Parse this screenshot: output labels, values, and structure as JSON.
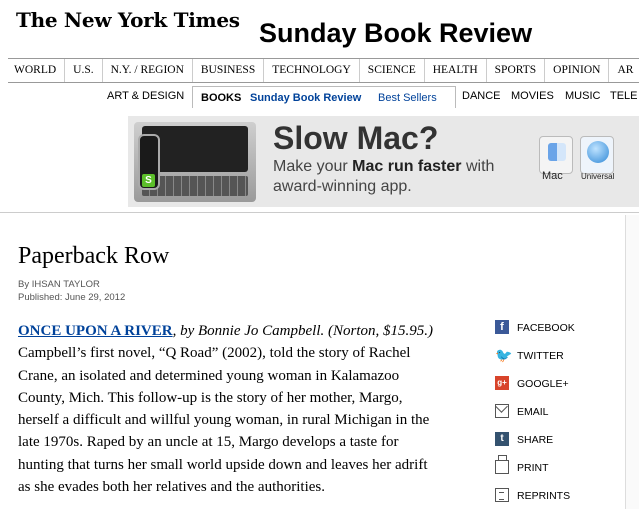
{
  "masthead": {
    "logo": "The New York Times",
    "section_title": "Sunday Book Review"
  },
  "nav_primary": [
    "WORLD",
    "U.S.",
    "N.Y. / REGION",
    "BUSINESS",
    "TECHNOLOGY",
    "SCIENCE",
    "HEALTH",
    "SPORTS",
    "OPINION",
    "AR"
  ],
  "nav_secondary": {
    "art_design": "ART & DESIGN",
    "books": "BOOKS",
    "sunday_book_review": "Sunday Book Review",
    "best_sellers": "Best Sellers",
    "dance": "DANCE",
    "movies": "MOVIES",
    "music": "MUSIC",
    "tele": "TELE"
  },
  "ad": {
    "headline": "Slow Mac?",
    "line1_prefix": "Make your ",
    "line1_bold": "Mac run faster",
    "line1_suffix": " with",
    "line2": "award-winning app.",
    "badge": "S",
    "icon1_label": "Mac",
    "icon2_label": "Universal"
  },
  "article": {
    "headline": "Paperback Row",
    "byline": "By IHSAN TAYLOR",
    "published": "Published: June 29, 2012",
    "book_title": "ONCE UPON A RIVER",
    "book_meta": ", by Bonnie Jo Campbell. (Norton, $15.95.)",
    "lines": [
      "Campbell’s first novel, “Q Road” (2002), told the story of Rachel",
      "Crane, an isolated and determined young woman in Kalamazoo",
      "County, Mich. This follow-up is the story of her mother, Margo,",
      "herself a difficult and willful young woman, in rural Michigan in the",
      "late 1970s. Raped by an uncle at 15, Margo develops a taste for",
      "hunting that turns her small world upside down and leaves her adrift",
      "as she evades both her relatives and the authorities."
    ]
  },
  "share": {
    "facebook": "FACEBOOK",
    "twitter": "TWITTER",
    "google": "GOOGLE+",
    "email": "EMAIL",
    "share": "SHARE",
    "print": "PRINT",
    "reprints": "REPRINTS",
    "gplus_icon": "g+",
    "fb_icon": "f",
    "tumblr_icon": "t",
    "twitter_icon": "🐦"
  },
  "colors": {
    "link": "#00429a",
    "facebook": "#3b5998",
    "twitter": "#29a9e1",
    "google": "#d8442b"
  }
}
